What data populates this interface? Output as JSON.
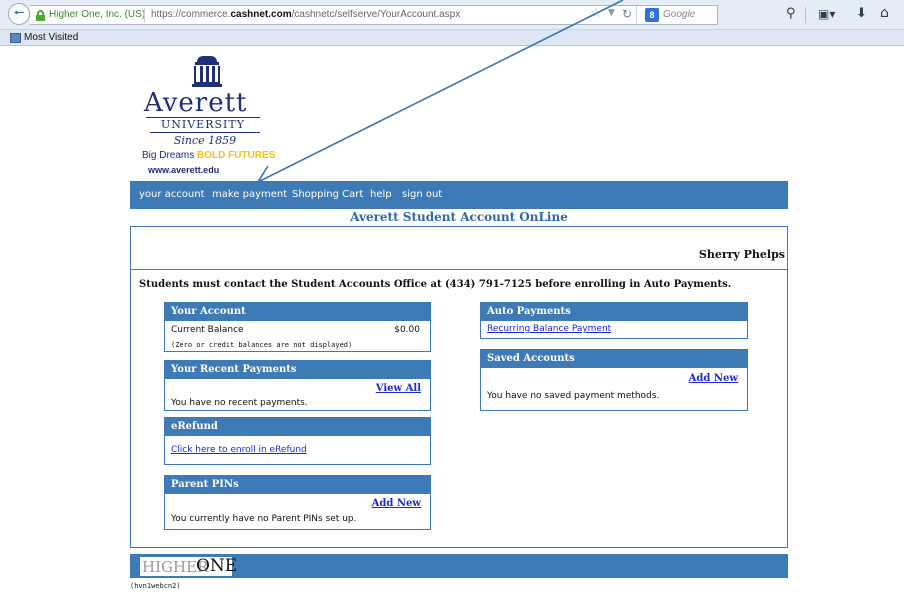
{
  "browser": {
    "site_identity": "Higher One, Inc. (US)",
    "url_prefix": "https://commerce.",
    "url_domain": "cashnet.com",
    "url_path": "/cashnetc/selfserve/YourAccount.aspx",
    "search_placeholder": "Google",
    "bookmark_label": "Most Visited"
  },
  "logo": {
    "name": "Averett",
    "university": "UNIVERSITY",
    "since": "Since 1859",
    "tagline_a": "Big Dreams",
    "tagline_b": "BOLD FUTURES",
    "url": "www.averett.edu"
  },
  "nav": {
    "items": [
      "your account",
      "make payment",
      "Shopping Cart",
      "help",
      "sign out"
    ]
  },
  "page": {
    "heading": "Averett Student Account OnLine",
    "user_name": "Sherry Phelps",
    "notice": "Students must contact the Student Accounts Office at (434) 791-7125 before enrolling in Auto Payments."
  },
  "panels": {
    "your_account": {
      "title": "Your Account",
      "balance_label": "Current Balance",
      "balance_value": "$0.00",
      "balance_note": "(Zero or credit balances are not displayed)"
    },
    "recent_payments": {
      "title": "Your Recent Payments",
      "link": "View All",
      "message": "You have no recent payments."
    },
    "erefund": {
      "title": "eRefund",
      "link": "Click here to enroll in eRefund"
    },
    "parent_pins": {
      "title": "Parent PINs",
      "link": "Add New",
      "message": "You currently have no Parent PINs set up."
    },
    "auto_payments": {
      "title": "Auto Payments",
      "link": "Recurring Balance Payment"
    },
    "saved_accounts": {
      "title": "Saved Accounts",
      "link": "Add New",
      "message": "You have no saved payment methods."
    }
  },
  "footer": {
    "logo_higher": "HIGHER",
    "logo_one": "ONE",
    "server_id": "(hvn1webcn2)"
  },
  "colors": {
    "brand_blue": "#3e7ab5",
    "heading_blue": "#2f6aa6",
    "link_blue": "#1a2bd6",
    "averett_navy": "#1f2f7a",
    "averett_gold": "#f0c419",
    "annotation_arrow": "#3b73b9"
  }
}
